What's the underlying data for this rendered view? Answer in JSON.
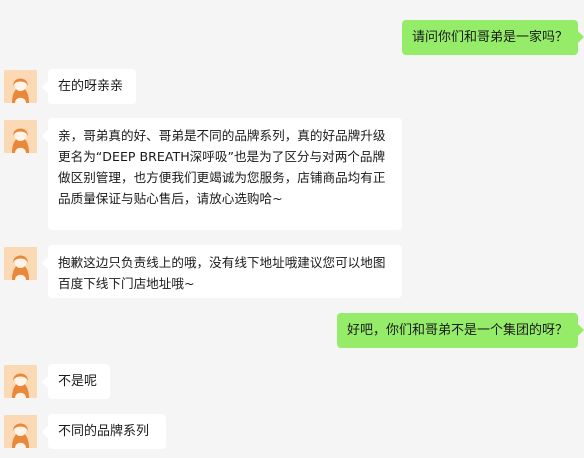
{
  "colors": {
    "background": "#f5f5f5",
    "outgoing_bubble": "#95ec69",
    "incoming_bubble": "#ffffff"
  },
  "messages": [
    {
      "side": "right",
      "text": "请问你们和哥弟是一家吗？"
    },
    {
      "side": "left",
      "avatar": "agent-avatar-icon",
      "text": "在的呀亲亲"
    },
    {
      "side": "left",
      "avatar": "agent-avatar-icon",
      "text": "亲，哥弟真的好、哥弟是不同的品牌系列，真的好品牌升级更名为“DEEP BREATH深呼吸”也是为了区分与对两个品牌做区别管理，也方便我们更竭诚为您服务，店铺商品均有正品质量保证与贴心售后，请放心选购哈~"
    },
    {
      "side": "left",
      "avatar": "agent-avatar-icon",
      "text": "抱歉这边只负责线上的哦，没有线下地址哦建议您可以地图百度下线下门店地址哦~"
    },
    {
      "side": "right",
      "text": "好吧，你们和哥弟不是一个集团的呀？"
    },
    {
      "side": "left",
      "avatar": "agent-avatar-icon",
      "text": "不是呢"
    },
    {
      "side": "left",
      "avatar": "agent-avatar-icon",
      "text": "不同的品牌系列"
    }
  ]
}
